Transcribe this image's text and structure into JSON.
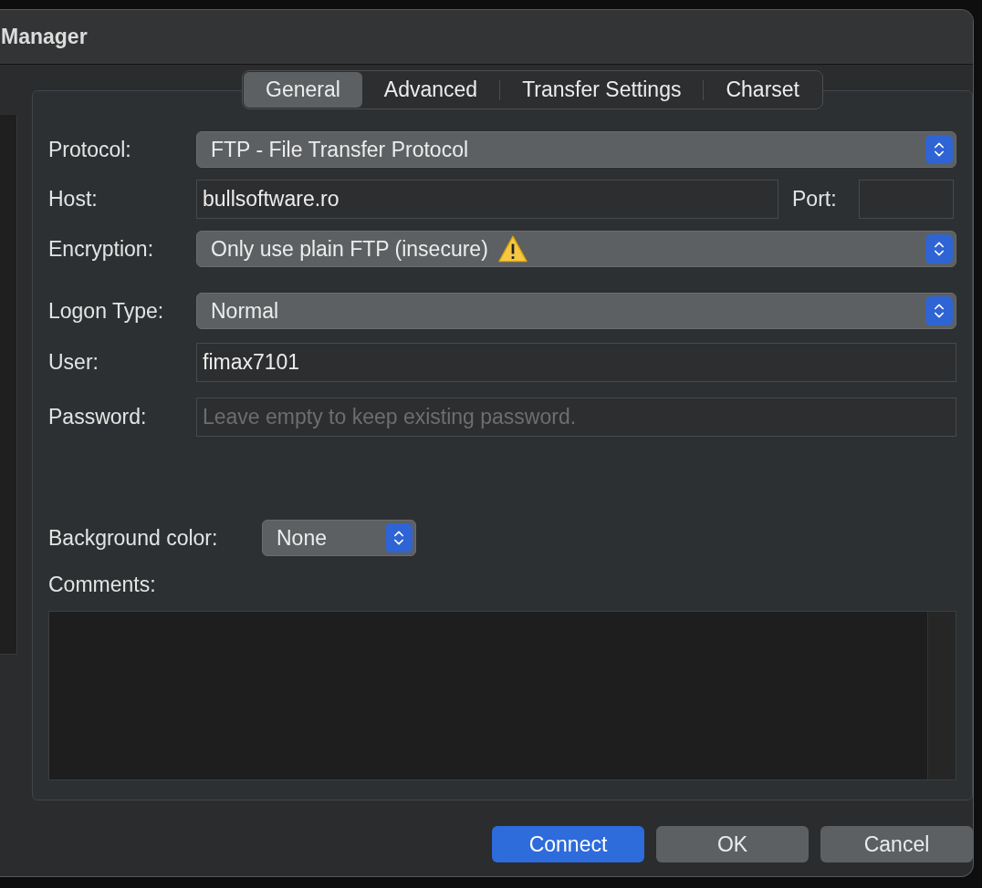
{
  "window": {
    "title": "Manager"
  },
  "tabs": [
    {
      "label": "General",
      "selected": true
    },
    {
      "label": "Advanced",
      "selected": false
    },
    {
      "label": "Transfer Settings",
      "selected": false
    },
    {
      "label": "Charset",
      "selected": false
    }
  ],
  "protocol": {
    "label": "Protocol:",
    "value": "FTP - File Transfer Protocol"
  },
  "host": {
    "label": "Host:",
    "value": "bullsoftware.ro"
  },
  "port": {
    "label": "Port:"
  },
  "encryption": {
    "label": "Encryption:",
    "value": "Only use plain FTP (insecure)",
    "warning": true
  },
  "logon_type": {
    "label": "Logon Type:",
    "value": "Normal"
  },
  "user": {
    "label": "User:",
    "value": "fimax7101"
  },
  "password": {
    "label": "Password:",
    "placeholder": "Leave empty to keep existing password."
  },
  "background_color": {
    "label": "Background color:",
    "value": "None"
  },
  "comments": {
    "label": "Comments:"
  },
  "buttons": [
    {
      "label": "Connect",
      "kind": "primary"
    },
    {
      "label": "OK",
      "kind": "normal"
    },
    {
      "label": "Cancel",
      "kind": "normal"
    }
  ]
}
